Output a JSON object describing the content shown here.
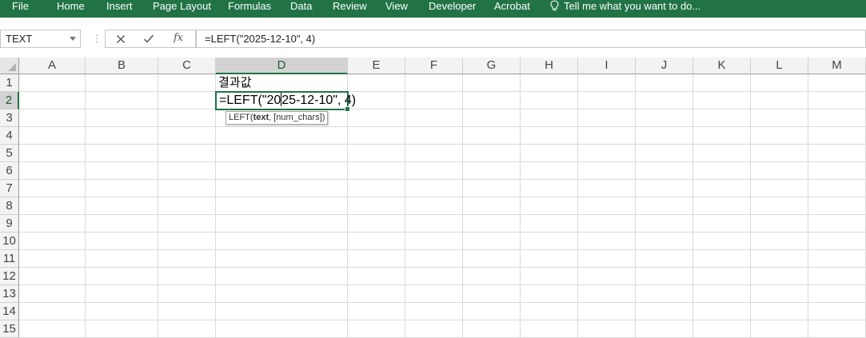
{
  "ribbon": {
    "tabs": [
      "File",
      "Home",
      "Insert",
      "Page Layout",
      "Formulas",
      "Data",
      "Review",
      "View",
      "Developer",
      "Acrobat"
    ],
    "tell_me": "Tell me what you want to do..."
  },
  "formula_bar": {
    "name_box": "TEXT",
    "fx_label": "fx",
    "formula": "=LEFT(\"2025-12-10\", 4)"
  },
  "columns": [
    "A",
    "B",
    "C",
    "D",
    "E",
    "F",
    "G",
    "H",
    "I",
    "J",
    "K",
    "L",
    "M"
  ],
  "rows": [
    "1",
    "2",
    "3",
    "4",
    "5",
    "6",
    "7",
    "8",
    "9",
    "10",
    "11",
    "12",
    "13",
    "14",
    "15"
  ],
  "cells": {
    "D1": "결과값",
    "D2_before_caret": "=LEFT(\"20",
    "D2_after_caret": "25-12-10\", 4)"
  },
  "tooltip": {
    "func": "LEFT(",
    "arg_active": "text",
    "rest": ", [num_chars])"
  },
  "colors": {
    "accent": "#217346",
    "header_bg": "#f3f3f3",
    "selected_header_bg": "#d3d3d3",
    "gridline": "#dadada"
  },
  "icons": [
    "lightbulb-icon",
    "dropdown-arrow-icon",
    "cancel-icon",
    "enter-icon",
    "insert-function-icon",
    "select-all-icon"
  ]
}
